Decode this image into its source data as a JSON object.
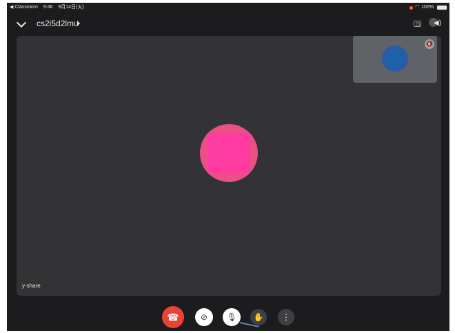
{
  "status_bar": {
    "app_back": "◀ Classroom",
    "time": "9:46",
    "date": "9月14日(火)",
    "battery": "100%"
  },
  "header": {
    "meeting_code": "cs2i5d2lmu",
    "icons": [
      "chevron-down-icon",
      "caret-right-icon",
      "camera-switch-icon",
      "speaker-icon"
    ]
  },
  "stage": {
    "presenter_name": "y-share",
    "self_view_mic": "muted"
  },
  "controls": {
    "end_call_glyph": "☎",
    "cam_glyph": "⊘",
    "mic_glyph": "🎙",
    "hand_glyph": "✋",
    "more_glyph": "⋮"
  },
  "colors": {
    "end_call": "#ea4335",
    "presenter_avatar": "#ff3aa0",
    "self_avatar": "#1f62a7",
    "stage_bg": "#333335"
  }
}
